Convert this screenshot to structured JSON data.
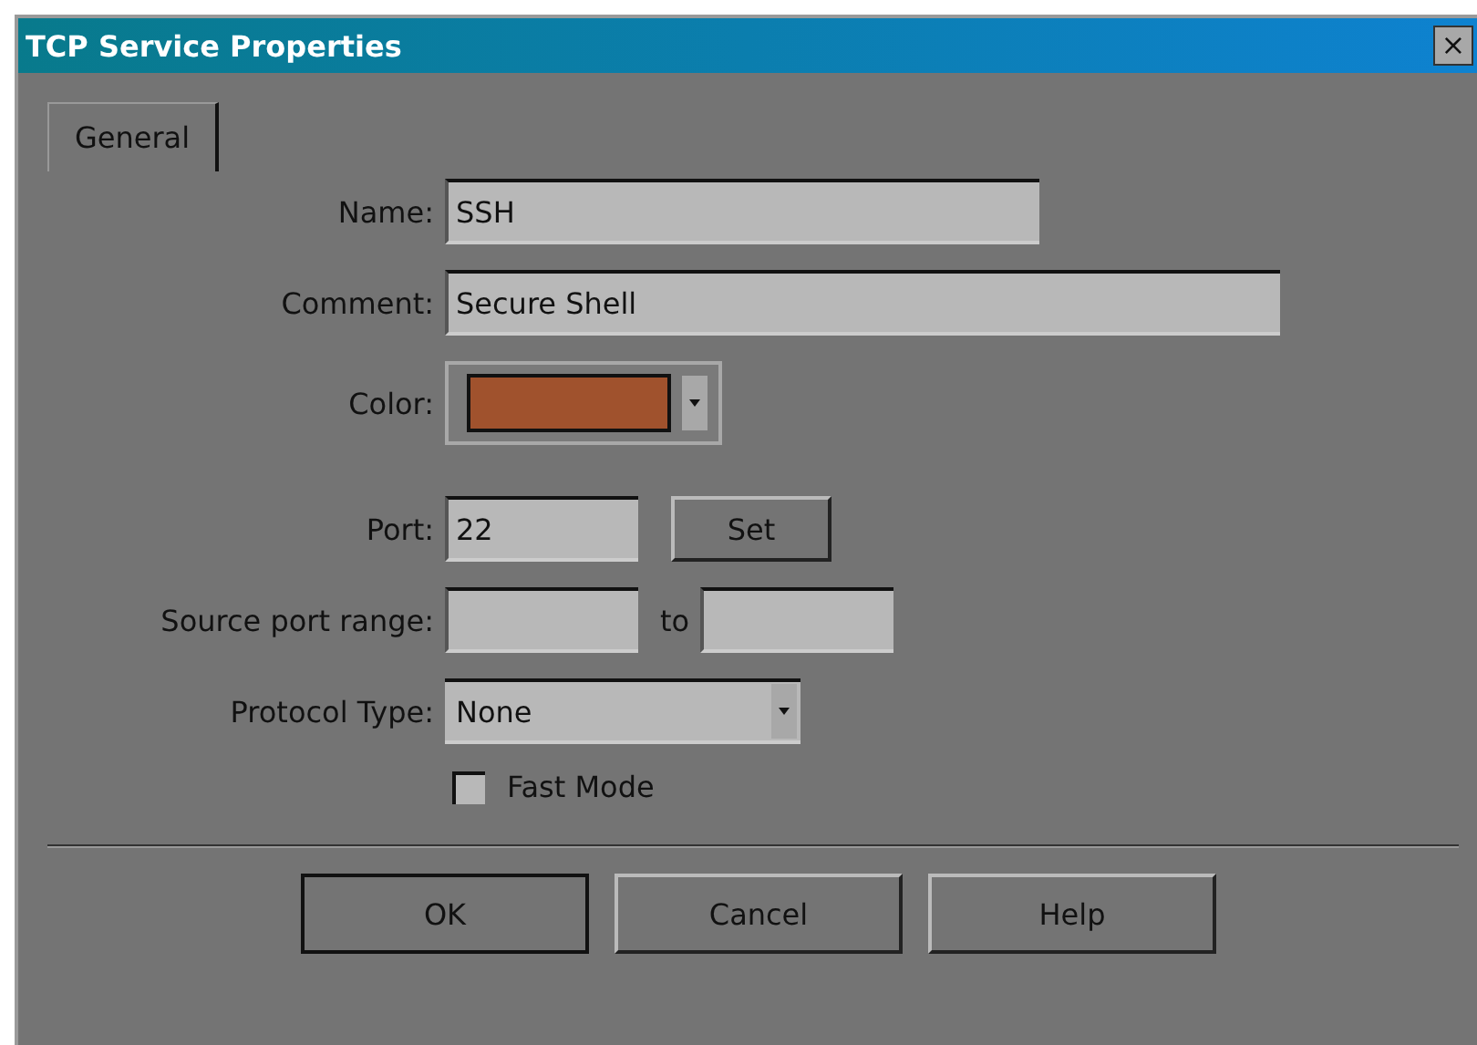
{
  "window": {
    "title": "TCP Service Properties",
    "close": "×"
  },
  "tabs": [
    {
      "label": "General",
      "selected": true
    }
  ],
  "form": {
    "name": {
      "label": "Name:",
      "value": "SSH"
    },
    "comment": {
      "label": "Comment:",
      "value": "Secure Shell"
    },
    "color": {
      "label": "Color:",
      "color": "#a0522d"
    },
    "port": {
      "label": "Port:",
      "value": "22",
      "button": "Set"
    },
    "source_range": {
      "label": "Source port range:",
      "separator": "to"
    },
    "protocol_type": {
      "label": "Protocol Type:",
      "value": "None"
    },
    "fast_mode": {
      "label": "Fast Mode",
      "checked": false
    }
  },
  "buttons": [
    {
      "label": "OK",
      "default": true
    },
    {
      "label": "Cancel",
      "default": false
    },
    {
      "label": "Help",
      "default": false
    }
  ]
}
